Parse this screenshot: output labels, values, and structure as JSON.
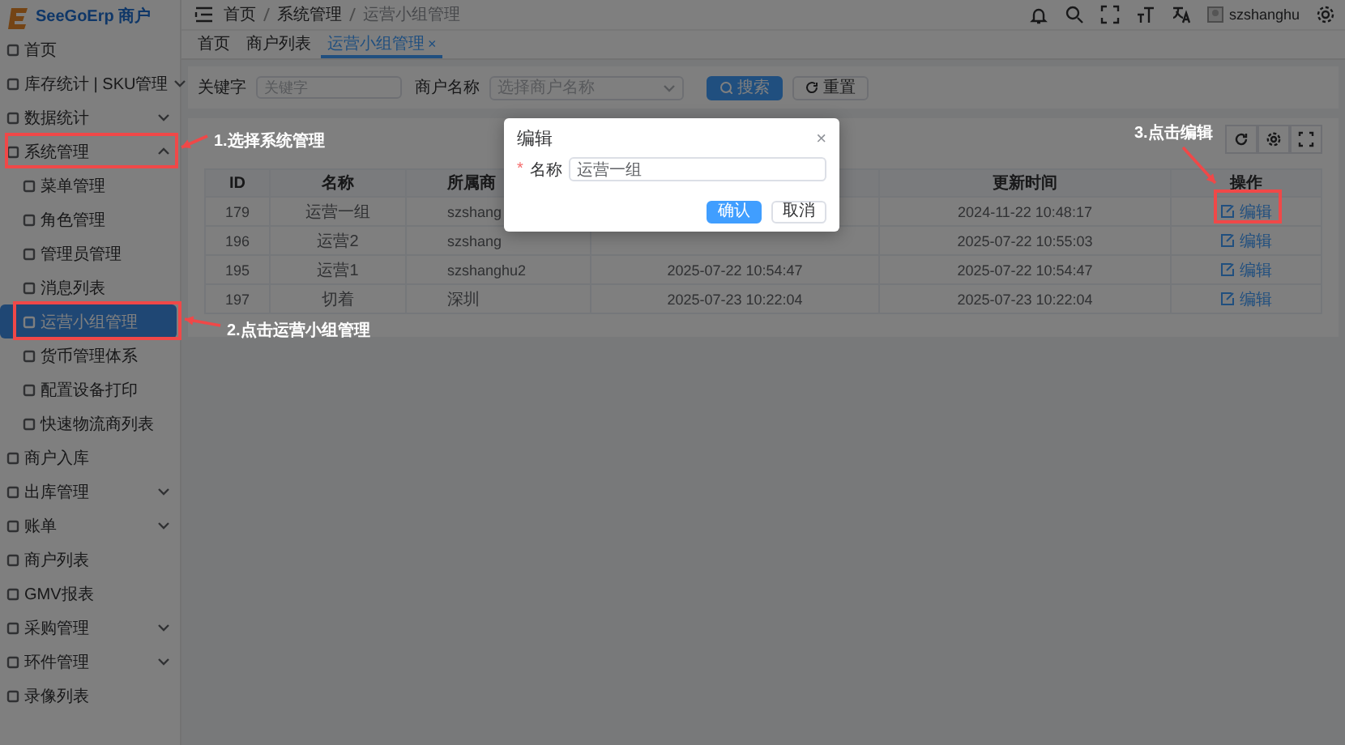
{
  "brand": {
    "name": "SeeGoErp 商户"
  },
  "sidebar": {
    "items": [
      {
        "label": "首页",
        "selected": false
      },
      {
        "label": "库存统计 | SKU管理",
        "expanded": false,
        "selected": false
      },
      {
        "label": "数据统计",
        "expanded": false,
        "selected": false
      },
      {
        "label": "系统管理",
        "expanded": true,
        "selected": false,
        "children": [
          {
            "label": "菜单管理",
            "selected": false
          },
          {
            "label": "角色管理",
            "selected": false
          },
          {
            "label": "管理员管理",
            "selected": false
          },
          {
            "label": "消息列表",
            "selected": false
          },
          {
            "label": "运营小组管理",
            "selected": true
          },
          {
            "label": "货币管理体系",
            "selected": false
          },
          {
            "label": "配置设备打印",
            "selected": false
          },
          {
            "label": "快速物流商列表",
            "selected": false
          }
        ]
      },
      {
        "label": "商户入库",
        "selected": false
      },
      {
        "label": "出库管理",
        "expanded": false,
        "selected": false
      },
      {
        "label": "账单",
        "expanded": false,
        "selected": false
      },
      {
        "label": "商户列表",
        "selected": false
      },
      {
        "label": "GMV报表",
        "selected": false
      },
      {
        "label": "采购管理",
        "expanded": false,
        "selected": false
      },
      {
        "label": "环件管理",
        "expanded": false,
        "selected": false
      },
      {
        "label": "录像列表",
        "selected": false
      }
    ]
  },
  "breadcrumb": [
    "首页",
    "系统管理",
    "运营小组管理"
  ],
  "user": {
    "name": "szshanghu"
  },
  "tabs": [
    {
      "label": "首页",
      "selected": false
    },
    {
      "label": "商户列表",
      "selected": false
    },
    {
      "label": "运营小组管理",
      "selected": true,
      "close": "×"
    }
  ],
  "search": {
    "fields": [
      {
        "label": "关键字",
        "kind": "input",
        "placeholder": "关键字"
      },
      {
        "label": "商户名称",
        "kind": "select",
        "placeholder": "选择商户名称"
      }
    ],
    "buttons": [
      {
        "label": "搜索",
        "kind": "primary"
      },
      {
        "label": "重置",
        "kind": "default"
      }
    ]
  },
  "table": {
    "columns": [
      "ID",
      "名称",
      "所属商",
      null,
      "更新时间",
      "操作"
    ],
    "rows": [
      {
        "cells": [
          "179",
          "运营一组",
          "szshang",
          null,
          "2024-11-22 10:48:17"
        ],
        "action": "编辑"
      },
      {
        "cells": [
          "196",
          "运营2",
          "szshang",
          null,
          "2025-07-22 10:55:03"
        ],
        "action": "编辑"
      },
      {
        "cells": [
          "195",
          "运营1",
          "szshanghu2",
          "2025-07-22 10:54:47",
          "2025-07-22 10:54:47"
        ],
        "action": "编辑"
      },
      {
        "cells": [
          "197",
          "切着",
          "深圳",
          "2025-07-23 10:22:04",
          "2025-07-23 10:22:04"
        ],
        "action": "编辑"
      }
    ]
  },
  "dialog": {
    "title": "编辑",
    "close": "×",
    "field": {
      "mark": "*",
      "label": "名称",
      "value": "运营一组"
    },
    "buttons": [
      {
        "label": "确认",
        "kind": "primary"
      },
      {
        "label": "取消",
        "kind": "default"
      }
    ]
  },
  "annotations": [
    {
      "text": "1.选择系统管理"
    },
    {
      "text": "2.点击运营小组管理"
    },
    {
      "text": "3.点击编辑"
    }
  ]
}
